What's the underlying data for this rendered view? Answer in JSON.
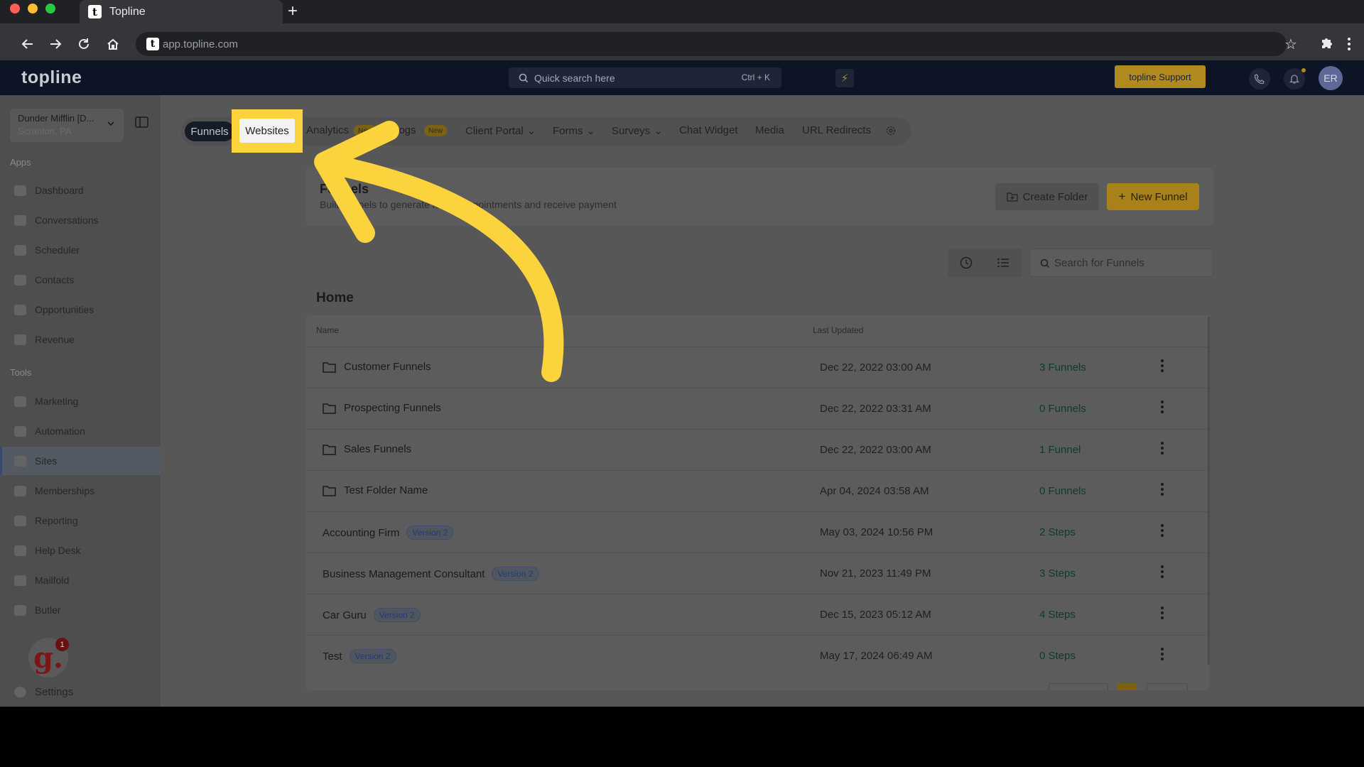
{
  "browser": {
    "tab_title": "Topline",
    "tab_favicon": "t",
    "url": "app.topline.com",
    "traffic_colors": [
      "#ff5f57",
      "#febc2e",
      "#28c840"
    ]
  },
  "header": {
    "logo": "topline",
    "search_placeholder": "Quick search here",
    "search_shortcut": "Ctrl + K",
    "support_label": "topline Support",
    "avatar_initials": "ER"
  },
  "sidebar": {
    "account_name": "Dunder Mifflin [D...",
    "account_location": "Scranton, PA",
    "apps_heading": "Apps",
    "apps": [
      {
        "label": "Dashboard",
        "icon": "dashboard-icon"
      },
      {
        "label": "Conversations",
        "icon": "chat-icon"
      },
      {
        "label": "Scheduler",
        "icon": "calendar-icon"
      },
      {
        "label": "Contacts",
        "icon": "person-icon"
      },
      {
        "label": "Opportunities",
        "icon": "target-icon"
      },
      {
        "label": "Revenue",
        "icon": "card-icon"
      }
    ],
    "tools_heading": "Tools",
    "tools": [
      {
        "label": "Marketing",
        "icon": "megaphone-icon"
      },
      {
        "label": "Automation",
        "icon": "gears-icon"
      },
      {
        "label": "Sites",
        "icon": "globe-icon",
        "active": true
      },
      {
        "label": "Memberships",
        "icon": "members-icon"
      },
      {
        "label": "Reporting",
        "icon": "pie-icon"
      },
      {
        "label": "Help Desk",
        "icon": "help-icon"
      },
      {
        "label": "Mailfold",
        "icon": "mail-icon"
      },
      {
        "label": "Butler",
        "icon": "butler-icon"
      }
    ],
    "badge_letter": "g.",
    "badge_count": "1",
    "settings_label": "Settings"
  },
  "tabs": {
    "funnels": "Funnels",
    "websites": "Websites",
    "analytics": "Analytics",
    "analytics_badge": "New",
    "blogs": "Blogs",
    "blogs_badge": "New",
    "client_portal": "Client Portal",
    "forms": "Forms",
    "surveys": "Surveys",
    "chat_widget": "Chat Widget",
    "media": "Media",
    "url_redirects": "URL Redirects"
  },
  "banner": {
    "title": "Funnels",
    "subtitle": "Build funnels to generate leads, appointments and receive payment",
    "create_folder": "Create Folder",
    "new_funnel": "New Funnel"
  },
  "list": {
    "search_placeholder": "Search for Funnels",
    "section_title": "Home",
    "col_name": "Name",
    "col_updated": "Last Updated",
    "rows": [
      {
        "name": "Customer Funnels",
        "folder": true,
        "date": "Dec 22, 2022 03:00 AM",
        "count": "3 Funnels"
      },
      {
        "name": "Prospecting Funnels",
        "folder": true,
        "date": "Dec 22, 2022 03:31 AM",
        "count": "0 Funnels"
      },
      {
        "name": "Sales Funnels",
        "folder": true,
        "date": "Dec 22, 2022 03:00 AM",
        "count": "1 Funnel"
      },
      {
        "name": "Test Folder Name",
        "folder": true,
        "date": "Apr 04, 2024 03:58 AM",
        "count": "0 Funnels"
      },
      {
        "name": "Accounting Firm",
        "folder": false,
        "version": "Version 2",
        "date": "May 03, 2024 10:56 PM",
        "count": "2 Steps"
      },
      {
        "name": "Business Management Consultant",
        "folder": false,
        "version": "Version 2",
        "date": "Nov 21, 2023 11:49 PM",
        "count": "3 Steps"
      },
      {
        "name": "Car Guru",
        "folder": false,
        "version": "Version 2",
        "date": "Dec 15, 2023 05:12 AM",
        "count": "4 Steps"
      },
      {
        "name": "Test",
        "folder": false,
        "version": "Version 2",
        "date": "May 17, 2024 06:49 AM",
        "count": "0 Steps"
      }
    ]
  },
  "colors": {
    "highlight": "#fbd33c",
    "arrow": "#fbd33c",
    "brand_gold": "#b08a1e"
  }
}
